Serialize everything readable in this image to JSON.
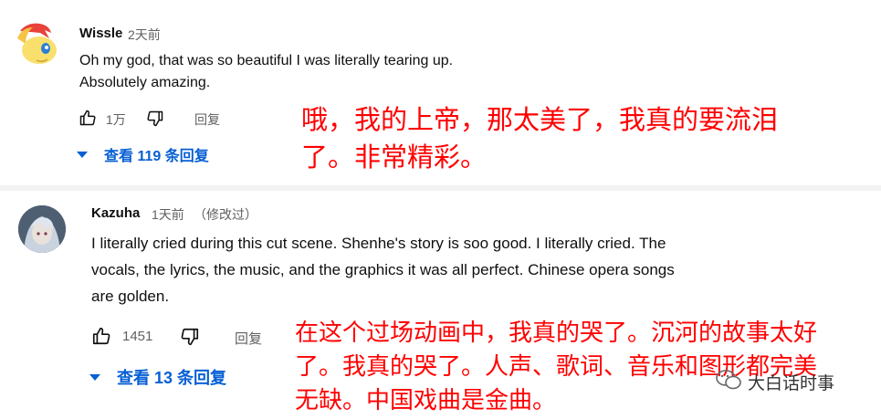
{
  "comments": [
    {
      "author": "Wissle",
      "time": "2天前",
      "edited": "",
      "lines": [
        "Oh my god, that was so beautiful I was literally tearing up.",
        "Absolutely amazing."
      ],
      "likes": "1万",
      "reply_label": "回复",
      "view_replies": "查看 119 条回复",
      "translation": [
        "哦，我的上帝，那太美了，我真的要流泪",
        "了。非常精彩。"
      ]
    },
    {
      "author": "Kazuha",
      "time": "1天前",
      "edited": "（修改过）",
      "lines": [
        "I literally cried during this cut scene. Shenhe's story is soo good. I literally cried. The",
        "vocals, the lyrics, the music, and the graphics it was all perfect. Chinese opera songs",
        "are golden."
      ],
      "likes": "1451",
      "reply_label": "回复",
      "view_replies": "查看 13 条回复",
      "translation": [
        "在这个过场动画中，我真的哭了。沉河的故事太好",
        "了。我真的哭了。人声、歌词、音乐和图形都完美",
        "无缺。中国戏曲是金曲。"
      ]
    }
  ],
  "watermark": "大白话时事",
  "colors": {
    "link": "#065fd4",
    "translation": "#ff0000",
    "secondary": "#606060"
  }
}
